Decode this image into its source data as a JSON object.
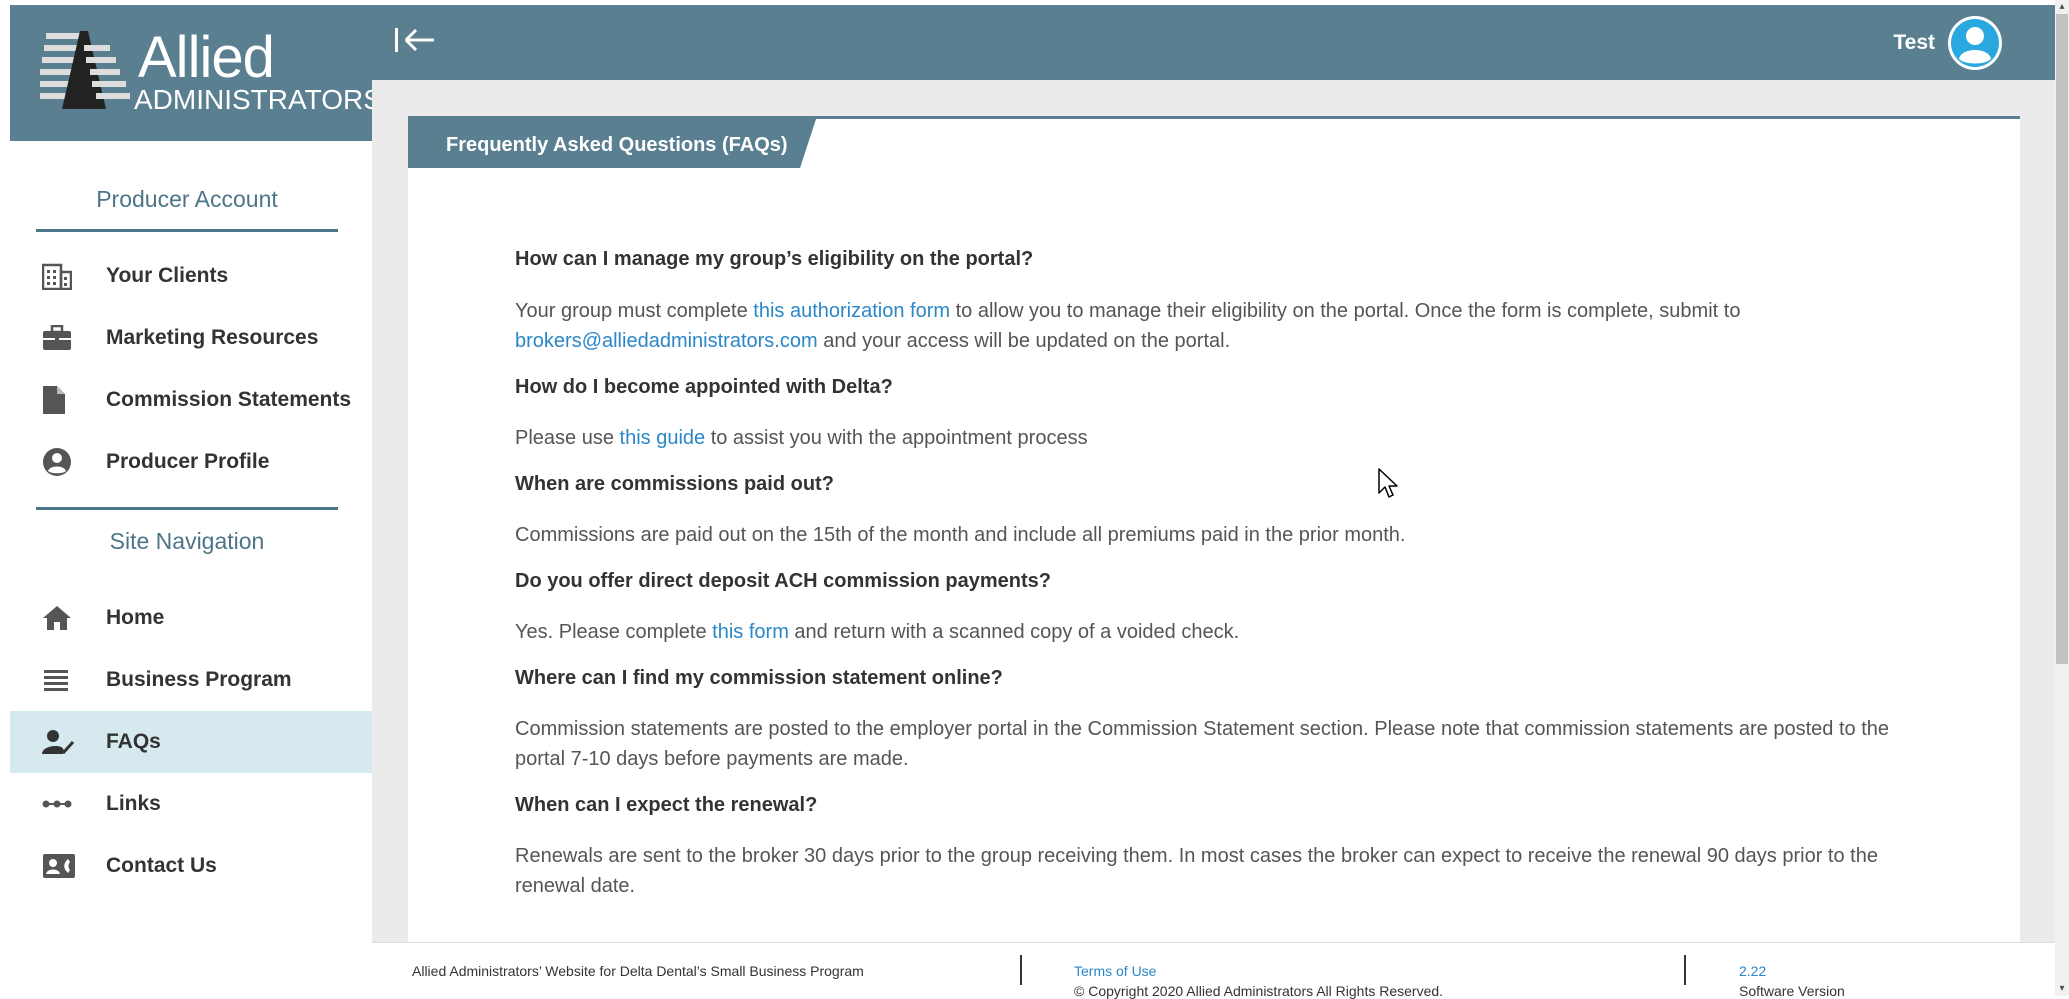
{
  "brand": {
    "name_line1": "Allied",
    "name_line2": "ADMINISTRATORS",
    "color": "#5a7f90"
  },
  "sidebar": {
    "section1_title": "Producer Account",
    "section2_title": "Site Navigation",
    "account_items": [
      {
        "label": "Your Clients",
        "icon": "building-icon"
      },
      {
        "label": "Marketing Resources",
        "icon": "briefcase-icon"
      },
      {
        "label": "Commission Statements",
        "icon": "file-icon"
      },
      {
        "label": "Producer Profile",
        "icon": "user-circle-icon"
      }
    ],
    "nav_items": [
      {
        "label": "Home",
        "icon": "home-icon"
      },
      {
        "label": "Business Program",
        "icon": "list-icon"
      },
      {
        "label": "FAQs",
        "icon": "user-check-icon",
        "active": true
      },
      {
        "label": "Links",
        "icon": "link-dots-icon"
      },
      {
        "label": "Contact Us",
        "icon": "contact-card-icon"
      }
    ]
  },
  "topbar": {
    "user_name": "Test"
  },
  "panel": {
    "title": "Frequently Asked Questions (FAQs)"
  },
  "faqs": [
    {
      "q": "How can I manage my group’s eligibility on the portal?",
      "a1_pre": "Your group must complete ",
      "a1_link": "this authorization form",
      "a1_post": " to allow you to manage their eligibility on the portal. Once the form is complete, submit to ",
      "a1_email": "brokers@alliedadministrators.com",
      "a1_end": " and your access will be updated on the portal."
    },
    {
      "q": "How do I become appointed with Delta?",
      "a_pre": "Please use ",
      "a_link": "this guide",
      "a_post": " to assist you with the appointment process"
    },
    {
      "q": "When are commissions paid out?",
      "a": "Commissions are paid out on the 15th of the month and include all premiums paid in the prior month."
    },
    {
      "q": "Do you offer direct deposit ACH commission payments?",
      "a_pre": "Yes. Please complete ",
      "a_link": "this form",
      "a_post": " and return with a scanned copy of a voided check."
    },
    {
      "q": "Where can I find my commission statement online?",
      "a": "Commission statements are posted to the employer portal in the Commission Statement section. Please note that commission statements are posted to the portal 7-10 days before payments are made."
    },
    {
      "q": "When can I expect the renewal?",
      "a": "Renewals are sent to the broker 30 days prior to the group receiving them. In most cases the broker can expect to receive the renewal 90 days prior to the renewal date."
    }
  ],
  "footer": {
    "left": "Allied Administrators’ Website for Delta Dental’s Small Business Program",
    "copyright": "© Copyright 2020 Allied Administrators All Rights Reserved.",
    "terms": "Terms of Use",
    "version_label": "Software Version",
    "version": "2.22"
  }
}
